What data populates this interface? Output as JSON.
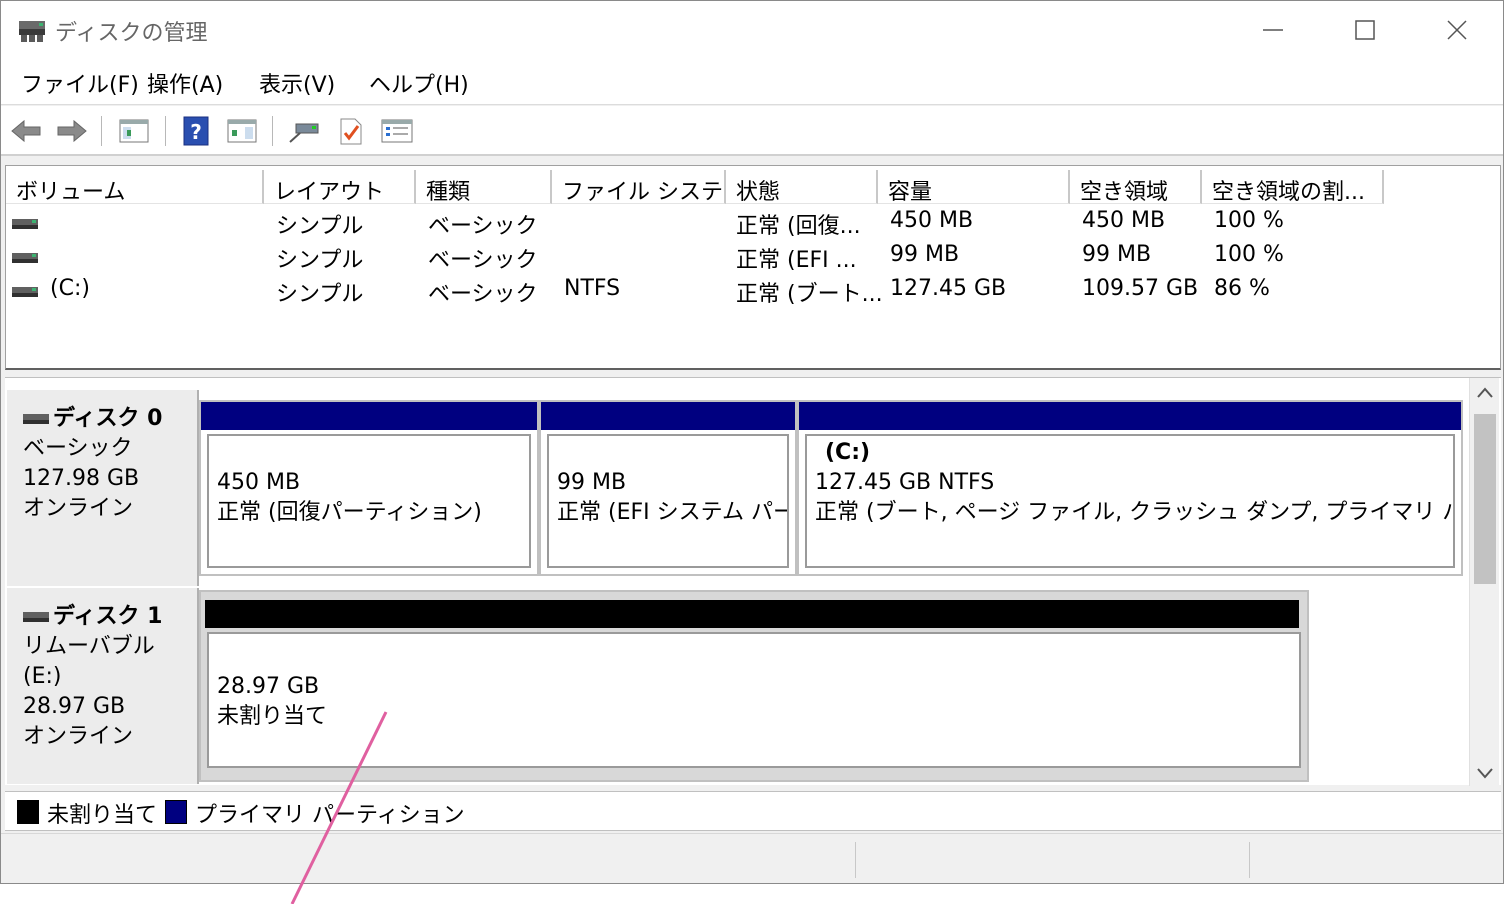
{
  "window": {
    "title": "ディスクの管理"
  },
  "menu": [
    "ファイル(F)",
    "操作(A)",
    "表示(V)",
    "ヘルプ(H)"
  ],
  "toolbar_icons": [
    "back-arrow-icon",
    "forward-arrow-icon",
    "console-tree-icon",
    "help-icon",
    "action-pane-icon",
    "connect-disk-icon",
    "check-icon",
    "properties-icon"
  ],
  "list": {
    "columns": [
      "ボリューム",
      "レイアウト",
      "種類",
      "ファイル システム",
      "状態",
      "容量",
      "空き領域",
      "空き領域の割..."
    ],
    "rows": [
      {
        "volume": "",
        "layout": "シンプル",
        "type": "ベーシック",
        "fs": "",
        "status": "正常 (回復...",
        "capacity": "450 MB",
        "free": "450 MB",
        "pct": "100 %"
      },
      {
        "volume": "",
        "layout": "シンプル",
        "type": "ベーシック",
        "fs": "",
        "status": "正常 (EFI ...",
        "capacity": "99 MB",
        "free": "99 MB",
        "pct": "100 %"
      },
      {
        "volume": "(C:)",
        "layout": "シンプル",
        "type": "ベーシック",
        "fs": "NTFS",
        "status": "正常 (ブート...",
        "capacity": "127.45 GB",
        "free": "109.57 GB",
        "pct": "86 %"
      }
    ]
  },
  "disks": [
    {
      "name": "ディスク 0",
      "type": "ベーシック",
      "size": "127.98 GB",
      "state": "オンライン",
      "partitions": [
        {
          "title": "",
          "size": "450 MB",
          "status": "正常 (回復パーティション)"
        },
        {
          "title": "",
          "size": "99 MB",
          "status": "正常 (EFI システム パーテ"
        },
        {
          "title": "(C:)",
          "size": "127.45 GB NTFS",
          "status": "正常 (ブート, ページ ファイル, クラッシュ ダンプ, プライマリ パーティション"
        }
      ]
    },
    {
      "name": "ディスク 1",
      "type": "リムーバブル (E:)",
      "size": "28.97 GB",
      "state": "オンライン",
      "partitions": [
        {
          "size": "28.97 GB",
          "status": "未割り当て"
        }
      ]
    }
  ],
  "legend": {
    "unallocated": "未割り当て",
    "primary": "プライマリ パーティション"
  },
  "colors": {
    "primary_partition": "#000080",
    "unallocated": "#000000",
    "annotation_line": "#e060a0"
  }
}
